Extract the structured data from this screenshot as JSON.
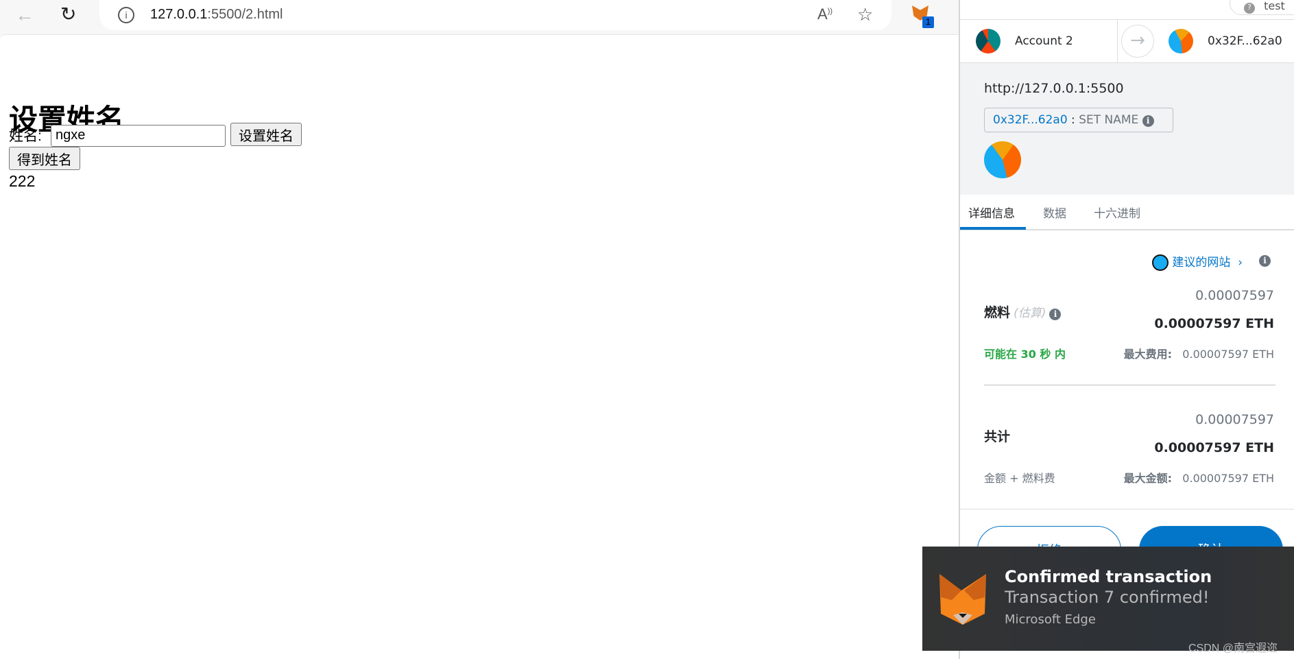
{
  "browser": {
    "url_host": "127.0.0.1",
    "url_rest": ":5500/2.html",
    "extension_badge": "1",
    "icons": [
      "back-arrow-icon",
      "refresh-icon",
      "info-icon",
      "read-aloud-icon",
      "star-icon",
      "metamask-fox-icon"
    ]
  },
  "page": {
    "title": "设置姓名",
    "name_label": "姓名:",
    "name_input_value": "ngxe",
    "set_name_button": "设置姓名",
    "get_name_button": "得到姓名",
    "result": "222"
  },
  "metamask": {
    "network_label": "test",
    "from_account": "Account 2",
    "to_address": "0x32F...62a0",
    "origin": "http://127.0.0.1:5500",
    "contract_address": "0x32F...62a0",
    "method_separator": ":",
    "method": "SET NAME",
    "tabs": [
      {
        "label": "详细信息",
        "active": true
      },
      {
        "label": "数据",
        "active": false
      },
      {
        "label": "十六进制",
        "active": false
      }
    ],
    "suggested_site": "建议的网站",
    "gas": {
      "label": "燃料",
      "estimate_label": "(估算)",
      "value": "0.00007597",
      "value_eth": "0.00007597 ETH",
      "timing": "可能在 30 秒 内",
      "max_fee_label": "最大费用:",
      "max_fee": "0.00007597 ETH"
    },
    "total": {
      "label": "共计",
      "value": "0.00007597",
      "value_eth": "0.00007597 ETH",
      "sub_label": "金额 + 燃料费",
      "max_amount_label": "最大金额:",
      "max_amount": "0.00007597 ETH"
    },
    "reject_button": "拒绝",
    "confirm_button": "确认",
    "colors": {
      "accent": "#0376c9",
      "success": "#28a745"
    }
  },
  "toast": {
    "title": "Confirmed transaction",
    "message": "Transaction 7 confirmed!",
    "source": "Microsoft Edge"
  },
  "watermark": "CSDN @南宫遐迩"
}
